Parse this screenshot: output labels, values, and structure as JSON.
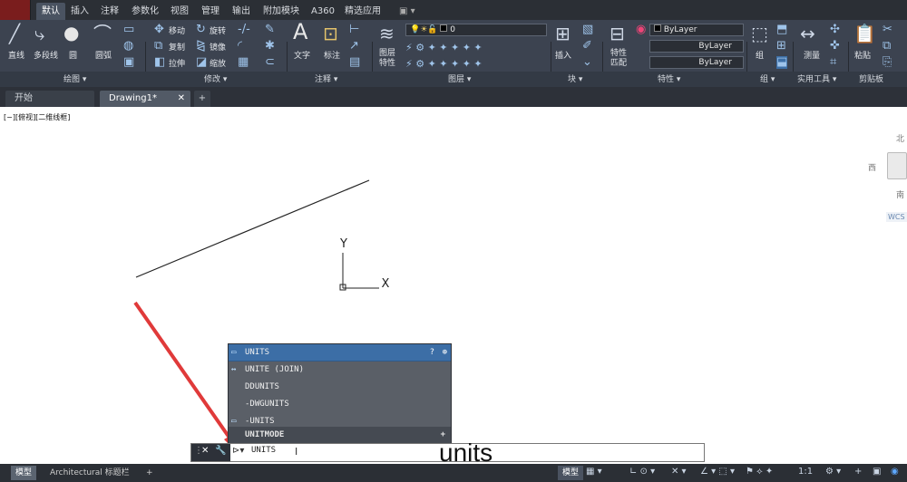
{
  "ribbon": {
    "tabs": [
      "默认",
      "插入",
      "注释",
      "参数化",
      "视图",
      "管理",
      "输出",
      "附加模块",
      "A360",
      "精选应用"
    ],
    "panels": [
      "绘图",
      "修改",
      "注释",
      "图层",
      "块",
      "特性",
      "组",
      "实用工具",
      "剪贴板"
    ],
    "draw_tools": [
      "直线",
      "多段线",
      "圆",
      "圆弧"
    ],
    "modify_tools": [
      "移动",
      "旋转",
      "复制",
      "镜像",
      "拉伸",
      "缩放"
    ],
    "annot_tools": [
      "文字",
      "标注"
    ],
    "layer_tools": [
      "图层\n特性"
    ],
    "layer_value": "0",
    "block_tools": [
      "插入"
    ],
    "props_tools": [
      "特性\n匹配"
    ],
    "bylayer": [
      "ByLayer",
      "ByLayer",
      "ByLayer"
    ],
    "group_label": "组",
    "measure_label": "测量",
    "paste_label": "粘贴"
  },
  "doc_tabs": [
    "开始",
    "Drawing1*"
  ],
  "canvas": {
    "view_label": "[−][俯视][二维线框]",
    "compass": {
      "north": "北",
      "west": "西",
      "south": "南",
      "wcs": "WCS"
    },
    "axis": {
      "y": "Y",
      "x": "X"
    }
  },
  "autocomplete": {
    "items": [
      "UNITS",
      "UNITE (JOIN)",
      "DDUNITS",
      "-DWGUNITS",
      "-UNITS"
    ],
    "category": "UNITMODE"
  },
  "command": {
    "prompt": "UNITS"
  },
  "annotation_text": "units",
  "status": {
    "tabs": [
      "模型",
      "Architectural 标题栏"
    ],
    "model_label": "模型",
    "scale": "1:1"
  },
  "colors": {
    "accent": "#3c6ea6",
    "arrow": "#e03a3a"
  }
}
